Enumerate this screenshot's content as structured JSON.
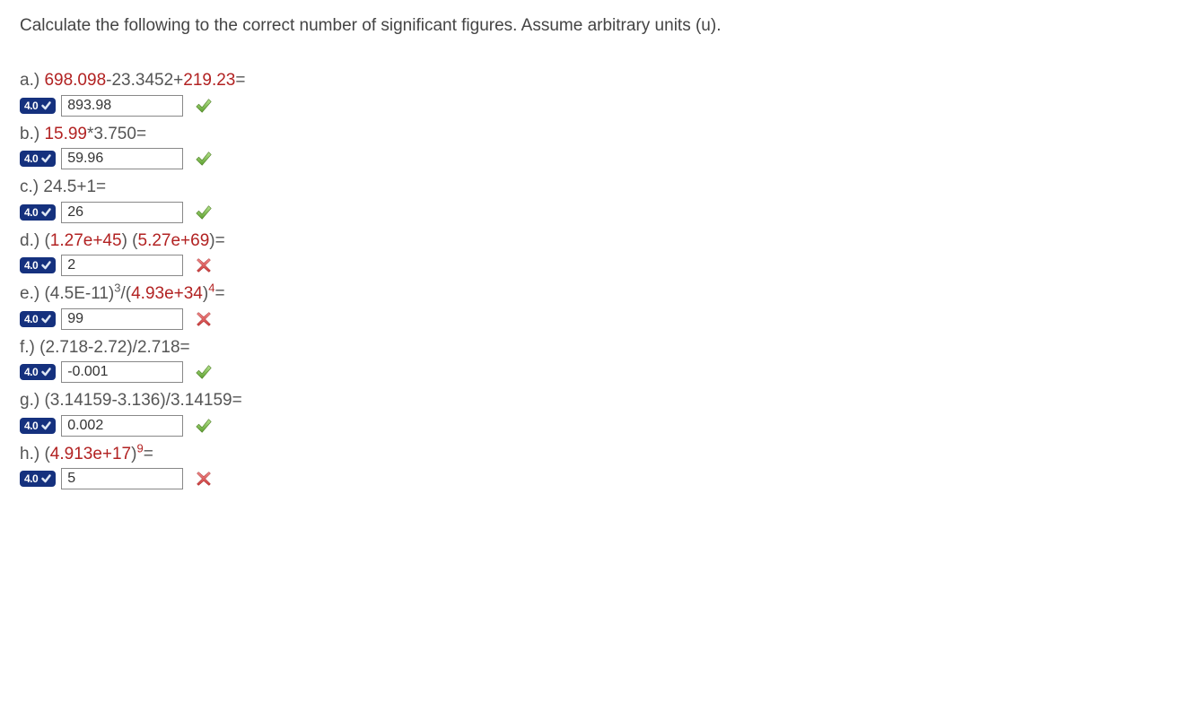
{
  "instruction": "Calculate the following to the correct number of significant figures. Assume arbitrary units (u).",
  "badge": {
    "text": "4.0"
  },
  "problems": [
    {
      "label": "a.) ",
      "parts": [
        {
          "t": "698.098",
          "hl": true
        },
        {
          "t": "-23.3452+"
        },
        {
          "t": "219.23",
          "hl": true
        },
        {
          "t": "="
        }
      ],
      "answer": "893.98",
      "correct": true
    },
    {
      "label": "b.) ",
      "parts": [
        {
          "t": "15.99",
          "hl": true
        },
        {
          "t": "*3.750="
        }
      ],
      "answer": "59.96",
      "correct": true
    },
    {
      "label": "c.) ",
      "parts": [
        {
          "t": "24.5+1="
        }
      ],
      "answer": "26",
      "correct": true
    },
    {
      "label": "d.) ",
      "parts": [
        {
          "t": "("
        },
        {
          "t": "1.27e+45",
          "hl": true
        },
        {
          "t": ") ("
        },
        {
          "t": "5.27e+69",
          "hl": true
        },
        {
          "t": ")="
        }
      ],
      "answer": "2",
      "correct": false
    },
    {
      "label": "e.) ",
      "parts": [
        {
          "t": "(4.5E-11)"
        },
        {
          "t": "3",
          "sup": true
        },
        {
          "t": "/("
        },
        {
          "t": "4.93e+34",
          "hl": true
        },
        {
          "t": ")"
        },
        {
          "t": "4",
          "sup": true,
          "hl": true
        },
        {
          "t": "="
        }
      ],
      "answer": "99",
      "correct": false
    },
    {
      "label": "f.) ",
      "parts": [
        {
          "t": "(2.718-2.72)/2.718="
        }
      ],
      "answer": "-0.001",
      "correct": true
    },
    {
      "label": "g.) ",
      "parts": [
        {
          "t": "(3.14159-3.136)/3.14159="
        }
      ],
      "answer": "0.002",
      "correct": true
    },
    {
      "label": "h.) ",
      "parts": [
        {
          "t": "("
        },
        {
          "t": "4.913e+17",
          "hl": true
        },
        {
          "t": ")"
        },
        {
          "t": "9",
          "sup": true,
          "hl": true
        },
        {
          "t": "="
        }
      ],
      "answer": "5",
      "correct": false
    }
  ]
}
